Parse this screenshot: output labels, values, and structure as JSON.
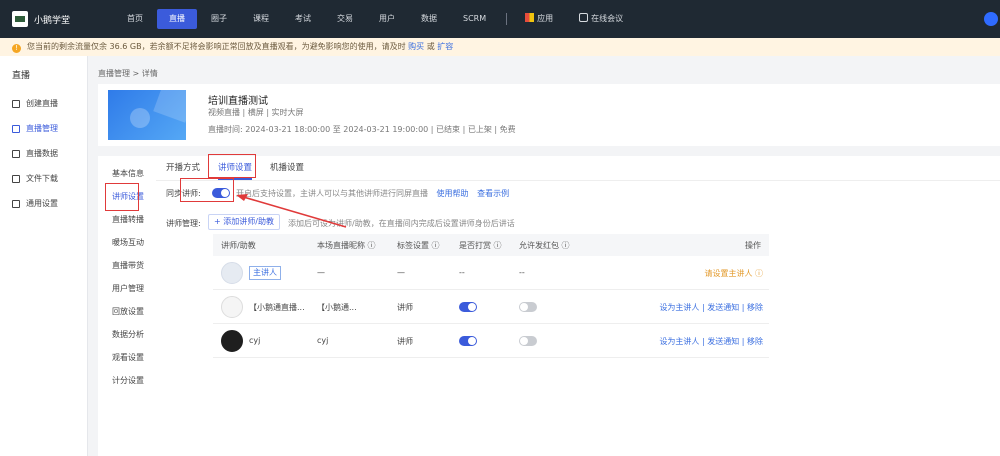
{
  "app": {
    "name": "小鹅学堂"
  },
  "nav": {
    "items": [
      "首页",
      "直播",
      "圈子",
      "课程",
      "考试",
      "交易",
      "用户",
      "数据",
      "SCRM"
    ],
    "active_index": 1,
    "apps_label": "应用",
    "live_label": "在线会议"
  },
  "notice": {
    "text": "您当前的剩余流量仅余 36.6 GB，若余额不足将会影响正常回放及直播观看，为避免影响您的使用，请及时",
    "link1": "购买",
    "mid": "或",
    "link2": "扩容"
  },
  "sidebar": {
    "title": "直播",
    "items": [
      {
        "label": "创建直播"
      },
      {
        "label": "直播管理"
      },
      {
        "label": "直播数据"
      },
      {
        "label": "文件下载"
      },
      {
        "label": "通用设置"
      }
    ],
    "active_index": 1
  },
  "breadcrumb": "直播管理 > 详情",
  "live": {
    "title": "培训直播测试",
    "meta": "视频直播 | 横屏 | 实时大屏",
    "time": "直播时间: 2024-03-21 18:00:00 至 2024-03-21 19:00:00 | 已结束 | 已上架 | 免费"
  },
  "subnav": {
    "items": [
      "基本信息",
      "讲师设置",
      "直播转播",
      "暖场互动",
      "直播带货",
      "用户管理",
      "回放设置",
      "数据分析",
      "观看设置",
      "计分设置"
    ],
    "active_index": 1
  },
  "tabs": {
    "items": [
      "开播方式",
      "讲师设置",
      "机播设置"
    ],
    "active_index": 1
  },
  "settings": {
    "toggle_label": "同步讲师:",
    "toggle_hint": "开启后支持设置，主讲人可以与其他讲师进行同屏直播",
    "link1": "使用帮助",
    "link2": "查看示例",
    "teachers_label": "讲师管理:",
    "add_button": "+ 添加讲师/助教",
    "add_hint": "添加后可设为讲师/助教，在直播间内完成后设置讲师身份后讲话"
  },
  "table": {
    "headers": [
      "讲师/助教",
      "本场直播昵称 ⓘ",
      "标签设置 ⓘ",
      "是否打赏 ⓘ",
      "允许发红包 ⓘ",
      "操作"
    ],
    "rows": [
      {
        "name": "主讲人",
        "nickname": "—",
        "tag": "—",
        "reward": "--",
        "redpacket": "--",
        "action": "请设置主讲人 ⓘ"
      },
      {
        "name": "【小鹅通直播...",
        "nickname": "【小鹅通...",
        "tag": "讲师",
        "reward": true,
        "redpacket": false,
        "action": "设为主讲人 | 发送通知 | 移除"
      },
      {
        "name": "cyj",
        "nickname": "cyj",
        "tag": "讲师",
        "reward": true,
        "redpacket": false,
        "action": "设为主讲人 | 发送通知 | 移除"
      }
    ]
  },
  "colors": {
    "accent": "#3b5bdb",
    "highlight": "#e03a3a"
  }
}
